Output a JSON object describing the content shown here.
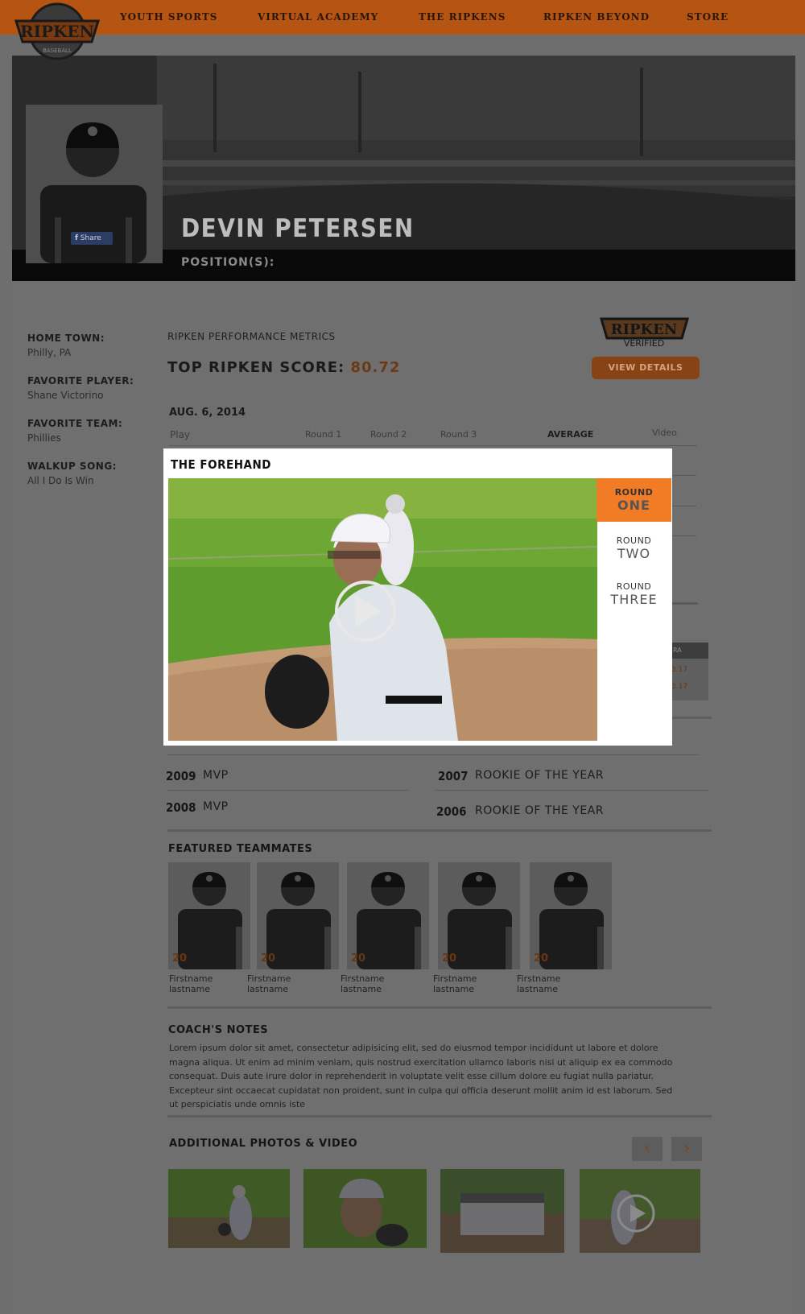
{
  "nav": {
    "logo_text": "RIPKEN",
    "logo_sub": "BASEBALL",
    "items": [
      "YOUTH SPORTS",
      "VIRTUAL ACADEMY",
      "THE RIPKENS",
      "RIPKEN BEYOND",
      "STORE"
    ]
  },
  "profile": {
    "name": "DEVIN PETERSEN",
    "positions_label": "POSITION(S):",
    "share_label": "Share",
    "home_town_label": "HOME TOWN:",
    "home_town": "Philly, PA",
    "favorite_player_label": "FAVORITE PLAYER:",
    "favorite_player": "Shane Victorino",
    "favorite_team_label": "FAVORITE TEAM:",
    "favorite_team": "Phillies",
    "walkup_song_label": "WALKUP SONG:",
    "walkup_song": "All I Do Is Win"
  },
  "metrics": {
    "title": "RIPKEN PERFORMANCE METRICS",
    "score_label": "TOP RIPKEN SCORE:",
    "score_value": "80.72",
    "verified_top": "RIPKEN",
    "verified_bottom": "VERIFIED",
    "view_details": "VIEW DETAILS",
    "date": "AUG. 6, 2014",
    "columns": [
      "Play",
      "Round 1",
      "Round 2",
      "Round 3",
      "AVERAGE",
      "Video"
    ],
    "side_head": "RA",
    "side_values": [
      "3.17",
      "3.17"
    ]
  },
  "awards": [
    {
      "year": "2009",
      "name": "MVP"
    },
    {
      "year": "2007",
      "name": "ROOKIE OF THE YEAR"
    },
    {
      "year": "2008",
      "name": "MVP"
    },
    {
      "year": "2006",
      "name": "ROOKIE OF THE YEAR"
    }
  ],
  "teammates": {
    "title": "FEATURED TEAMMATES",
    "items": [
      {
        "number": "20",
        "first": "Firstname",
        "last": "lastname"
      },
      {
        "number": "20",
        "first": "Firstname",
        "last": "lastname"
      },
      {
        "number": "20",
        "first": "Firstname",
        "last": "lastname"
      },
      {
        "number": "20",
        "first": "Firstname",
        "last": "lastname"
      },
      {
        "number": "20",
        "first": "Firstname",
        "last": "lastname"
      }
    ]
  },
  "coach_notes": {
    "title": "COACH'S NOTES",
    "text": "Lorem ipsum dolor sit amet, consectetur adipisicing elit, sed do eiusmod tempor incididunt ut labore et dolore magna aliqua. Ut enim ad minim veniam, quis nostrud exercitation ullamco laboris nisi ut aliquip ex ea commodo consequat. Duis aute irure dolor in reprehenderit in voluptate velit esse cillum dolore eu fugiat nulla pariatur. Excepteur sint occaecat cupidatat non proident, sunt in culpa qui officia deserunt mollit anim id est laborum. Sed ut perspiciatis unde omnis iste"
  },
  "media": {
    "title": "ADDITIONAL PHOTOS & VIDEO",
    "prev": "‹",
    "next": "›"
  },
  "modal": {
    "title": "THE FOREHAND",
    "rounds": [
      {
        "small": "ROUND",
        "big": "ONE",
        "active": true
      },
      {
        "small": "ROUND",
        "big": "TWO",
        "active": false
      },
      {
        "small": "ROUND",
        "big": "THREE",
        "active": false
      }
    ]
  },
  "colors": {
    "accent": "#f27b26",
    "nav_dimmed": "#b65412",
    "overlay_bg": "#6e6e6e"
  }
}
